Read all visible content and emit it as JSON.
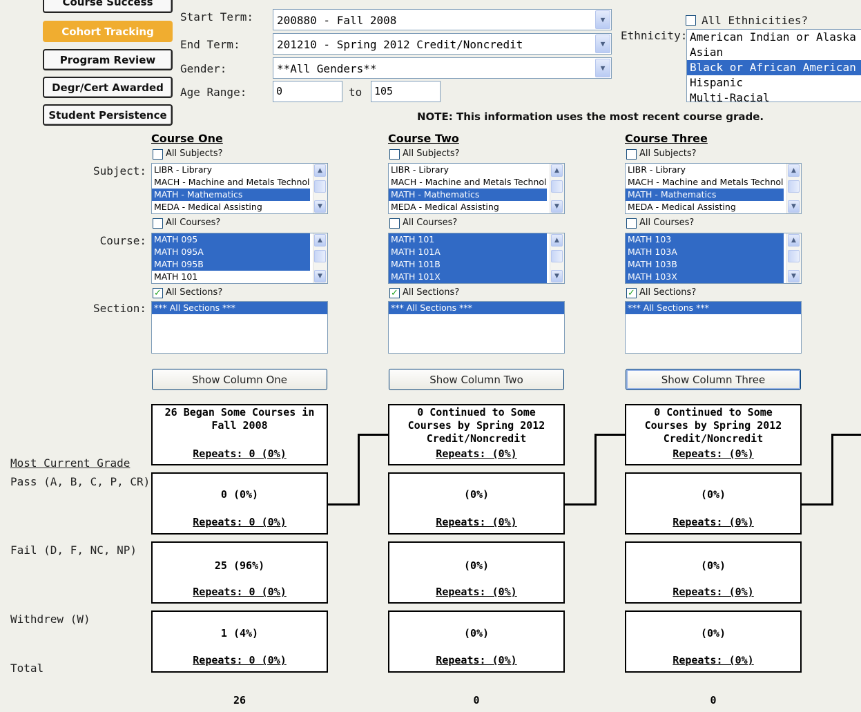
{
  "nav": {
    "course_success": "Course Success",
    "cohort_tracking": "Cohort Tracking",
    "program_review": "Program Review",
    "degr_cert_awarded": "Degr/Cert Awarded",
    "student_persistence": "Student Persistence"
  },
  "form": {
    "start_term_label": "Start Term:",
    "start_term_value": "200880 - Fall 2008",
    "end_term_label": "End Term:",
    "end_term_value": "201210 - Spring 2012 Credit/Noncredit",
    "gender_label": "Gender:",
    "gender_value": "**All Genders**",
    "age_range_label": "Age Range:",
    "age_from": "0",
    "age_to_label": "to",
    "age_to": "105",
    "all_ethnicities_label": "All Ethnicities?",
    "ethnicity_label": "Ethnicity:",
    "ethnicities": [
      "American Indian or Alaska Native",
      "Asian",
      "Black or African American",
      "Hispanic",
      "Multi-Racial"
    ],
    "selected_ethnicity": "Black or African American"
  },
  "note": "NOTE: This information uses the most recent course grade.",
  "labels": {
    "subject": "Subject:",
    "course": "Course:",
    "section": "Section:",
    "all_subjects": "All Subjects?",
    "all_courses": "All Courses?",
    "all_sections": "All Sections?",
    "most_current_grade": "Most Current Grade",
    "pass": "Pass (A, B, C, P, CR)",
    "fail": "Fail (D, F, NC, NP)",
    "withdrew": "Withdrew (W)",
    "total": "Total"
  },
  "columns": [
    {
      "header": "Course One",
      "subjects": [
        "LIBR - Library",
        "MACH - Machine and Metals Technology",
        "MATH - Mathematics",
        "MEDA - Medical Assisting"
      ],
      "courses": [
        "MATH 095",
        "MATH 095A",
        "MATH 095B",
        "MATH 101"
      ],
      "sections": [
        "*** All Sections ***"
      ],
      "show_button": "Show Column One",
      "summary": "26 Began Some Courses in Fall 2008",
      "summary_repeats": "Repeats: 0 (0%)",
      "pass": "0 (0%)",
      "pass_repeats": "Repeats: 0 (0%)",
      "fail": "25 (96%)",
      "fail_repeats": "Repeats: 0 (0%)",
      "withdrew": "1 (4%)",
      "withdrew_repeats": "Repeats: 0 (0%)",
      "total": "26"
    },
    {
      "header": "Course Two",
      "subjects": [
        "LIBR - Library",
        "MACH - Machine and Metals Technology",
        "MATH - Mathematics",
        "MEDA - Medical Assisting"
      ],
      "courses": [
        "MATH 101",
        "MATH 101A",
        "MATH 101B",
        "MATH 101X"
      ],
      "sections": [
        "*** All Sections ***"
      ],
      "show_button": "Show Column Two",
      "summary": "0 Continued to Some Courses by Spring 2012 Credit/Noncredit",
      "summary_repeats": "Repeats:  (0%)",
      "pass": "(0%)",
      "pass_repeats": "Repeats:  (0%)",
      "fail": "(0%)",
      "fail_repeats": "Repeats:  (0%)",
      "withdrew": "(0%)",
      "withdrew_repeats": "Repeats:  (0%)",
      "total": "0"
    },
    {
      "header": "Course Three",
      "subjects": [
        "LIBR - Library",
        "MACH - Machine and Metals Technology",
        "MATH - Mathematics",
        "MEDA - Medical Assisting"
      ],
      "courses": [
        "MATH 103",
        "MATH 103A",
        "MATH 103B",
        "MATH 103X"
      ],
      "sections": [
        "*** All Sections ***"
      ],
      "show_button": "Show Column Three",
      "summary": "0 Continued to Some Courses by Spring 2012 Credit/Noncredit",
      "summary_repeats": "Repeats:  (0%)",
      "pass": "(0%)",
      "pass_repeats": "Repeats:  (0%)",
      "fail": "(0%)",
      "fail_repeats": "Repeats:  (0%)",
      "withdrew": "(0%)",
      "withdrew_repeats": "Repeats:  (0%)",
      "total": "0"
    }
  ],
  "colors": {
    "active_nav": "#f0ad30",
    "selection": "#316ac5",
    "background": "#f0f0ea"
  }
}
